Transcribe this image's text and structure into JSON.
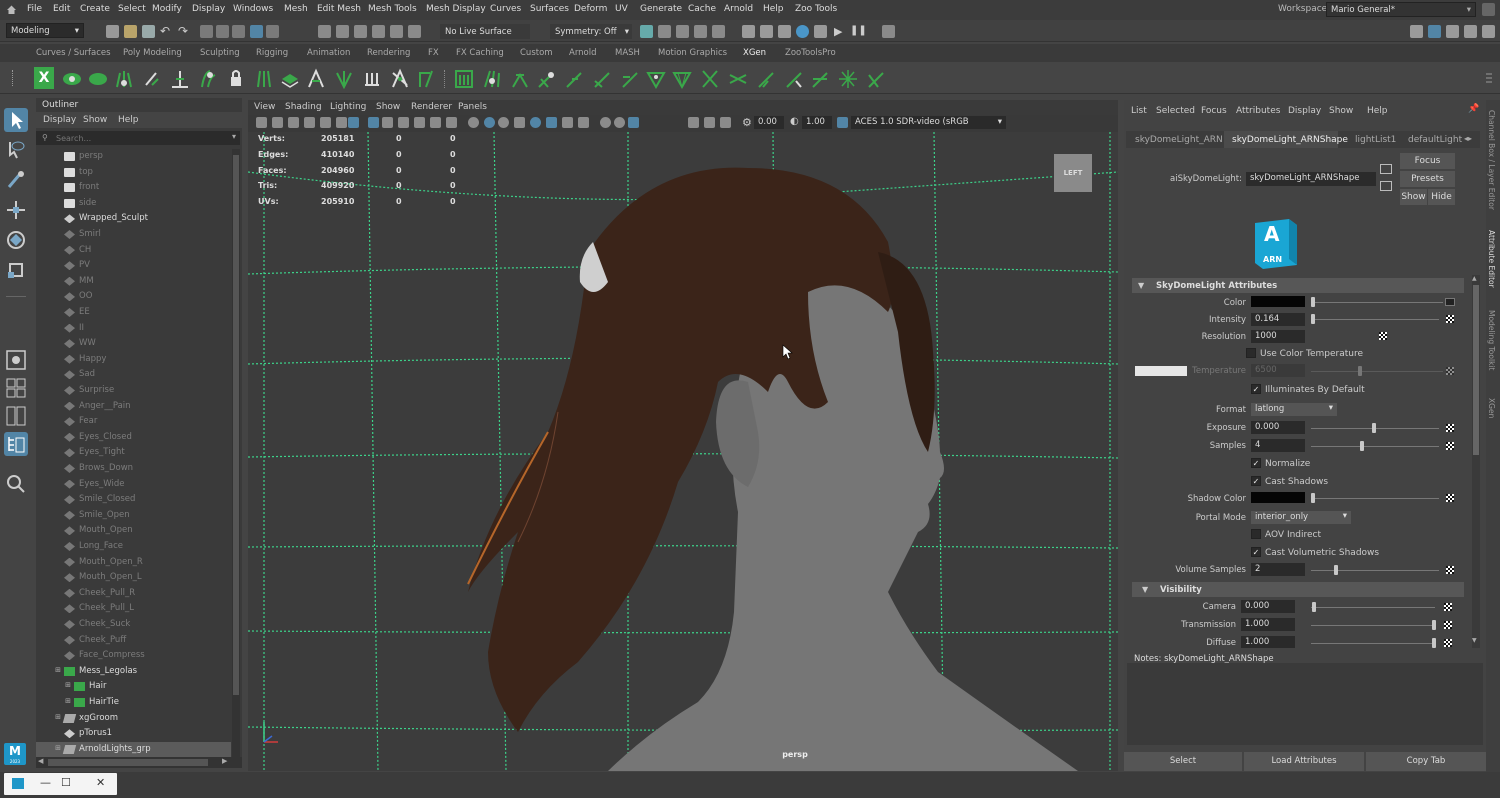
{
  "menubar": {
    "items": [
      "File",
      "Edit",
      "Create",
      "Select",
      "Modify",
      "Display",
      "Windows",
      "Mesh",
      "Edit Mesh",
      "Mesh Tools",
      "Mesh Display",
      "Curves",
      "Surfaces",
      "Deform",
      "UV",
      "Generate",
      "Cache",
      "Arnold",
      "Help",
      "Zoo Tools"
    ],
    "workspace_label": "Workspace:",
    "workspace_value": "Mario General*"
  },
  "statusline": {
    "mode": "Modeling",
    "live_surface": "No Live Surface",
    "symmetry": "Symmetry: Off"
  },
  "shelf": {
    "tabs": [
      "Curves / Surfaces",
      "Poly Modeling",
      "Sculpting",
      "Rigging",
      "Animation",
      "Rendering",
      "FX",
      "FX Caching",
      "Custom",
      "Arnold",
      "MASH",
      "Motion Graphics",
      "XGen",
      "ZooToolsPro"
    ],
    "active_tab": "XGen"
  },
  "outliner": {
    "title": "Outliner",
    "menu": [
      "Display",
      "Show",
      "Help"
    ],
    "search_placeholder": "Search...",
    "items": [
      "persp",
      "top",
      "front",
      "side",
      "Wrapped_Sculpt",
      "Smirl",
      "CH",
      "PV",
      "MM",
      "OO",
      "EE",
      "II",
      "WW",
      "Happy",
      "Sad",
      "Surprise",
      "Anger__Pain",
      "Fear",
      "Eyes_Closed",
      "Eyes_Tight",
      "Brows_Down",
      "Eyes_Wide",
      "Smile_Closed",
      "Smile_Open",
      "Mouth_Open",
      "Long_Face",
      "Mouth_Open_R",
      "Mouth_Open_L",
      "Cheek_Pull_R",
      "Cheek_Pull_L",
      "Cheek_Suck",
      "Cheek_Puff",
      "Face_Compress",
      "Mess_Legolas",
      "Hair",
      "HairTie",
      "xgGroom",
      "pTorus1",
      "ArnoldLights_grp"
    ]
  },
  "viewport": {
    "menu": [
      "View",
      "Shading",
      "Lighting",
      "Show",
      "Renderer",
      "Panels"
    ],
    "field_a": "0.00",
    "field_b": "1.00",
    "color_space": "ACES 1.0 SDR-video (sRGB",
    "camera_label": "persp",
    "viewcube_label": "LEFT",
    "hud": [
      {
        "label": "Verts:",
        "v1": "205181",
        "v2": "0",
        "v3": "0"
      },
      {
        "label": "Edges:",
        "v1": "410140",
        "v2": "0",
        "v3": "0"
      },
      {
        "label": "Faces:",
        "v1": "204960",
        "v2": "0",
        "v3": "0"
      },
      {
        "label": "Tris:",
        "v1": "409920",
        "v2": "0",
        "v3": "0"
      },
      {
        "label": "UVs:",
        "v1": "205910",
        "v2": "0",
        "v3": "0"
      }
    ]
  },
  "attribute_editor": {
    "menu": [
      "List",
      "Selected",
      "Focus",
      "Attributes",
      "Display",
      "Show",
      "Help"
    ],
    "tabs": [
      "skyDomeLight_ARN",
      "skyDomeLight_ARNShape",
      "lightList1",
      "defaultLight"
    ],
    "active_tab": "skyDomeLight_ARNShape",
    "node_label": "aiSkyDomeLight:",
    "node_value": "skyDomeLight_ARNShape",
    "focus_label": "Focus",
    "presets_label": "Presets",
    "show_label": "Show",
    "hide_label": "Hide",
    "logo_letter": "A",
    "logo_text": "ARN",
    "section1": "SkyDomeLight Attributes",
    "color_label": "Color",
    "intensity_label": "Intensity",
    "intensity_value": "0.164",
    "resolution_label": "Resolution",
    "resolution_value": "1000",
    "use_color_temp": "Use Color Temperature",
    "temperature_label": "Temperature",
    "temperature_value": "6500",
    "illuminates": "Illuminates By Default",
    "format_label": "Format",
    "format_value": "latlong",
    "exposure_label": "Exposure",
    "exposure_value": "0.000",
    "samples_label": "Samples",
    "samples_value": "4",
    "normalize": "Normalize",
    "cast_shadows": "Cast Shadows",
    "shadow_color_label": "Shadow Color",
    "portal_label": "Portal Mode",
    "portal_value": "interior_only",
    "aov_indirect": "AOV Indirect",
    "cast_vol_shadows": "Cast Volumetric Shadows",
    "vol_samples_label": "Volume Samples",
    "vol_samples_value": "2",
    "section2": "Visibility",
    "camera_label": "Camera",
    "camera_value": "0.000",
    "transmission_label": "Transmission",
    "transmission_value": "1.000",
    "diffuse_label": "Diffuse",
    "diffuse_value": "1.000",
    "notes_label": "Notes:  skyDomeLight_ARNShape",
    "select_btn": "Select",
    "load_btn": "Load Attributes",
    "copy_btn": "Copy Tab"
  },
  "side_tabs": [
    "Channel Box / Layer Editor",
    "Attribute Editor",
    "Modeling Toolkit",
    "XGen"
  ],
  "taskbar_logo": "M",
  "taskbar_sub": "2023",
  "colors": {
    "accent_blue": "#5285a6",
    "grid_green": "#3cd28a",
    "xgen_green": "#3aa84a",
    "hair_brown": "#3b2419"
  }
}
